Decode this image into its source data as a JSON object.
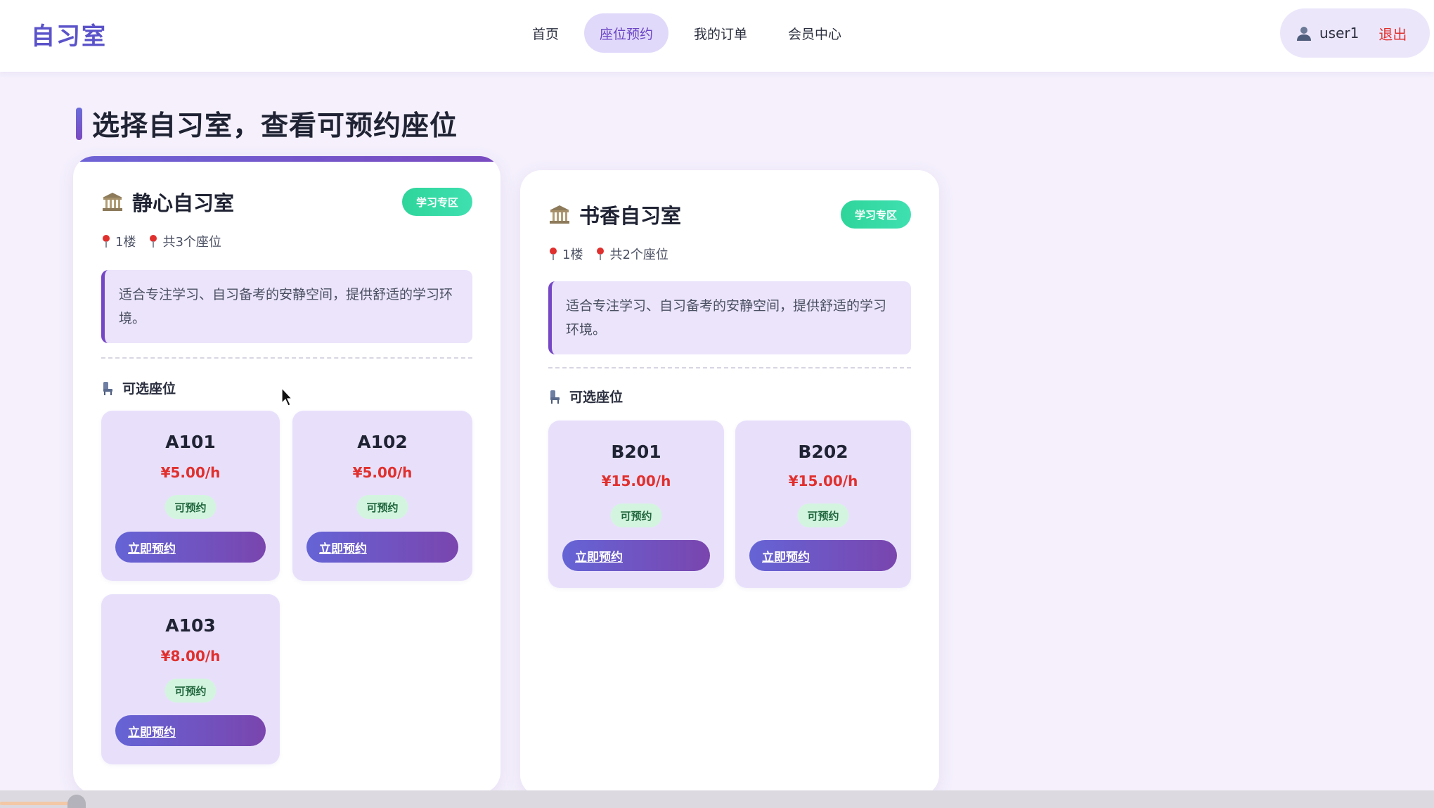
{
  "header": {
    "brand": "自习室",
    "nav": [
      {
        "label": "首页",
        "active": false
      },
      {
        "label": "座位预约",
        "active": true
      },
      {
        "label": "我的订单",
        "active": false
      },
      {
        "label": "会员中心",
        "active": false
      }
    ],
    "user": {
      "icon": "user-icon",
      "name": "user1",
      "logout_label": "退出"
    }
  },
  "page_title": "选择自习室，查看可预约座位",
  "rooms": [
    {
      "icon": "building-icon",
      "name": "静心自习室",
      "badge": "学习专区",
      "floor": "1楼",
      "seat_count": "共3个座位",
      "description": "适合专注学习、自习备考的安静空间，提供舒适的学习环境。",
      "seats_label": "可选座位",
      "seats": [
        {
          "code": "A101",
          "price": "¥5.00/h",
          "status": "可预约",
          "action": "立即预约"
        },
        {
          "code": "A102",
          "price": "¥5.00/h",
          "status": "可预约",
          "action": "立即预约"
        },
        {
          "code": "A103",
          "price": "¥8.00/h",
          "status": "可预约",
          "action": "立即预约"
        }
      ]
    },
    {
      "icon": "building-icon",
      "name": "书香自习室",
      "badge": "学习专区",
      "floor": "1楼",
      "seat_count": "共2个座位",
      "description": "适合专注学习、自习备考的安静空间，提供舒适的学习环境。",
      "seats_label": "可选座位",
      "seats": [
        {
          "code": "B201",
          "price": "¥15.00/h",
          "status": "可预约",
          "action": "立即预约"
        },
        {
          "code": "B202",
          "price": "¥15.00/h",
          "status": "可预约",
          "action": "立即预约"
        }
      ]
    }
  ],
  "colors": {
    "brand": "#5b53c9",
    "accent": "#7547c6",
    "price": "#e0302e",
    "status_bg": "#d3f5df",
    "badge": "#2ed59a"
  }
}
